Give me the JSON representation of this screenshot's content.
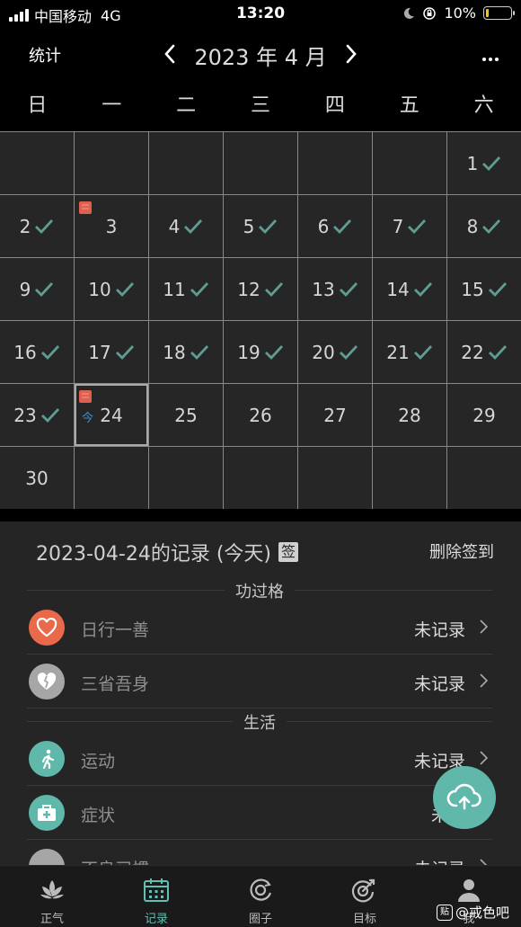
{
  "status_bar": {
    "carrier": "中国移动",
    "network": "4G",
    "time": "13:20",
    "battery": "10%",
    "battery_level": 0.1
  },
  "header": {
    "stats_label": "统计",
    "month_title": "2023 年 4 月"
  },
  "weekdays": [
    "日",
    "一",
    "二",
    "三",
    "四",
    "五",
    "六"
  ],
  "calendar": {
    "days": [
      {
        "n": "",
        "c": false
      },
      {
        "n": "",
        "c": false
      },
      {
        "n": "",
        "c": false
      },
      {
        "n": "",
        "c": false
      },
      {
        "n": "",
        "c": false
      },
      {
        "n": "",
        "c": false
      },
      {
        "n": "1",
        "c": true
      },
      {
        "n": "2",
        "c": true
      },
      {
        "n": "3",
        "c": false,
        "book": true
      },
      {
        "n": "4",
        "c": true
      },
      {
        "n": "5",
        "c": true
      },
      {
        "n": "6",
        "c": true
      },
      {
        "n": "7",
        "c": true
      },
      {
        "n": "8",
        "c": true
      },
      {
        "n": "9",
        "c": true
      },
      {
        "n": "10",
        "c": true
      },
      {
        "n": "11",
        "c": true
      },
      {
        "n": "12",
        "c": true
      },
      {
        "n": "13",
        "c": true
      },
      {
        "n": "14",
        "c": true
      },
      {
        "n": "15",
        "c": true
      },
      {
        "n": "16",
        "c": true
      },
      {
        "n": "17",
        "c": true
      },
      {
        "n": "18",
        "c": true
      },
      {
        "n": "19",
        "c": true
      },
      {
        "n": "20",
        "c": true
      },
      {
        "n": "21",
        "c": true
      },
      {
        "n": "22",
        "c": true
      },
      {
        "n": "23",
        "c": true
      },
      {
        "n": "24",
        "c": false,
        "book": true,
        "today": true
      },
      {
        "n": "25",
        "c": false
      },
      {
        "n": "26",
        "c": false
      },
      {
        "n": "27",
        "c": false
      },
      {
        "n": "28",
        "c": false
      },
      {
        "n": "29",
        "c": false
      },
      {
        "n": "30",
        "c": false
      },
      {
        "n": "",
        "c": false
      },
      {
        "n": "",
        "c": false
      },
      {
        "n": "",
        "c": false
      },
      {
        "n": "",
        "c": false
      },
      {
        "n": "",
        "c": false
      },
      {
        "n": "",
        "c": false
      }
    ],
    "today_tag": "今"
  },
  "records": {
    "title": "2023-04-24的记录 (今天)",
    "sign_badge": "签",
    "delete_label": "删除签到",
    "section_merit": "功过格",
    "section_life": "生活",
    "rows": [
      {
        "label": "日行一善",
        "status": "未记录"
      },
      {
        "label": "三省吾身",
        "status": "未记录"
      },
      {
        "label": "运动",
        "status": "未记录"
      },
      {
        "label": "症状",
        "status": "未记"
      },
      {
        "label": "不良习惯",
        "status": "未记录"
      }
    ]
  },
  "nav": [
    {
      "label": "正气"
    },
    {
      "label": "记录"
    },
    {
      "label": "圈子"
    },
    {
      "label": "目标"
    },
    {
      "label": "我"
    }
  ],
  "watermark": {
    "badge": "贴",
    "text": "@戒色吧"
  },
  "colors": {
    "accent": "#62bfb2",
    "check": "#5f9c93",
    "heart": "#e86a4a",
    "today_tag": "#3a8fd6"
  }
}
